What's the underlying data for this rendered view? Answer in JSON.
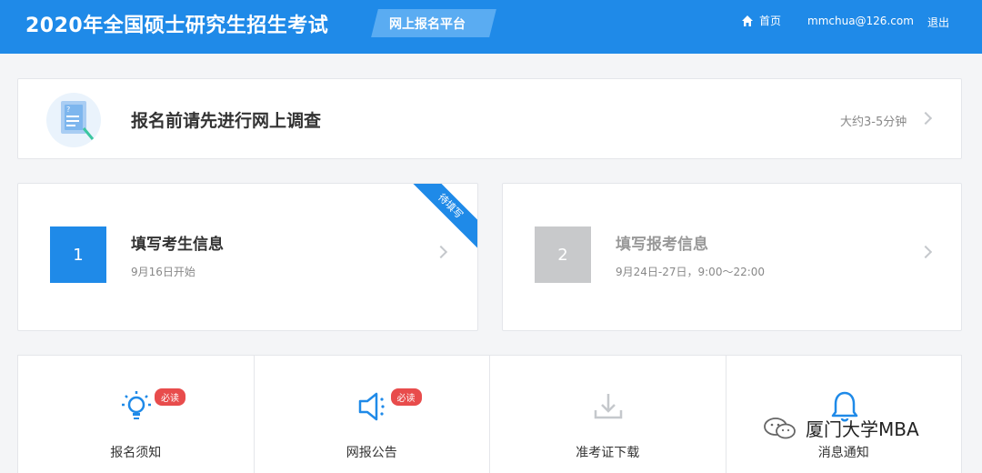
{
  "header": {
    "title": "2020年全国硕士研究生招生考试",
    "platform_tag": "网上报名平台",
    "nav_home": "首页",
    "user_email": "mmchua@126.com",
    "logout": "退出"
  },
  "survey": {
    "title": "报名前请先进行网上调查",
    "duration": "大约3-5分钟"
  },
  "steps": [
    {
      "number": "1",
      "title": "填写考生信息",
      "subtitle": "9月16日开始",
      "ribbon": "待填写",
      "active": true,
      "box_color": "#1f8ae8"
    },
    {
      "number": "2",
      "title": "填写报考信息",
      "subtitle": "9月24日-27日，9:00～22:00",
      "active": false,
      "box_color": "#c8c9cb"
    }
  ],
  "menu": [
    {
      "label": "报名须知",
      "icon": "lightbulb-icon",
      "badge": "必读"
    },
    {
      "label": "网报公告",
      "icon": "megaphone-icon",
      "badge": "必读"
    },
    {
      "label": "准考证下载",
      "icon": "download-icon",
      "badge": ""
    },
    {
      "label": "消息通知",
      "icon": "bell-icon",
      "badge": ""
    }
  ],
  "watermark": "厦门大学MBA",
  "colors": {
    "primary": "#1f8ae8",
    "badge": "#e84c4c",
    "inactive": "#c8c9cb"
  }
}
